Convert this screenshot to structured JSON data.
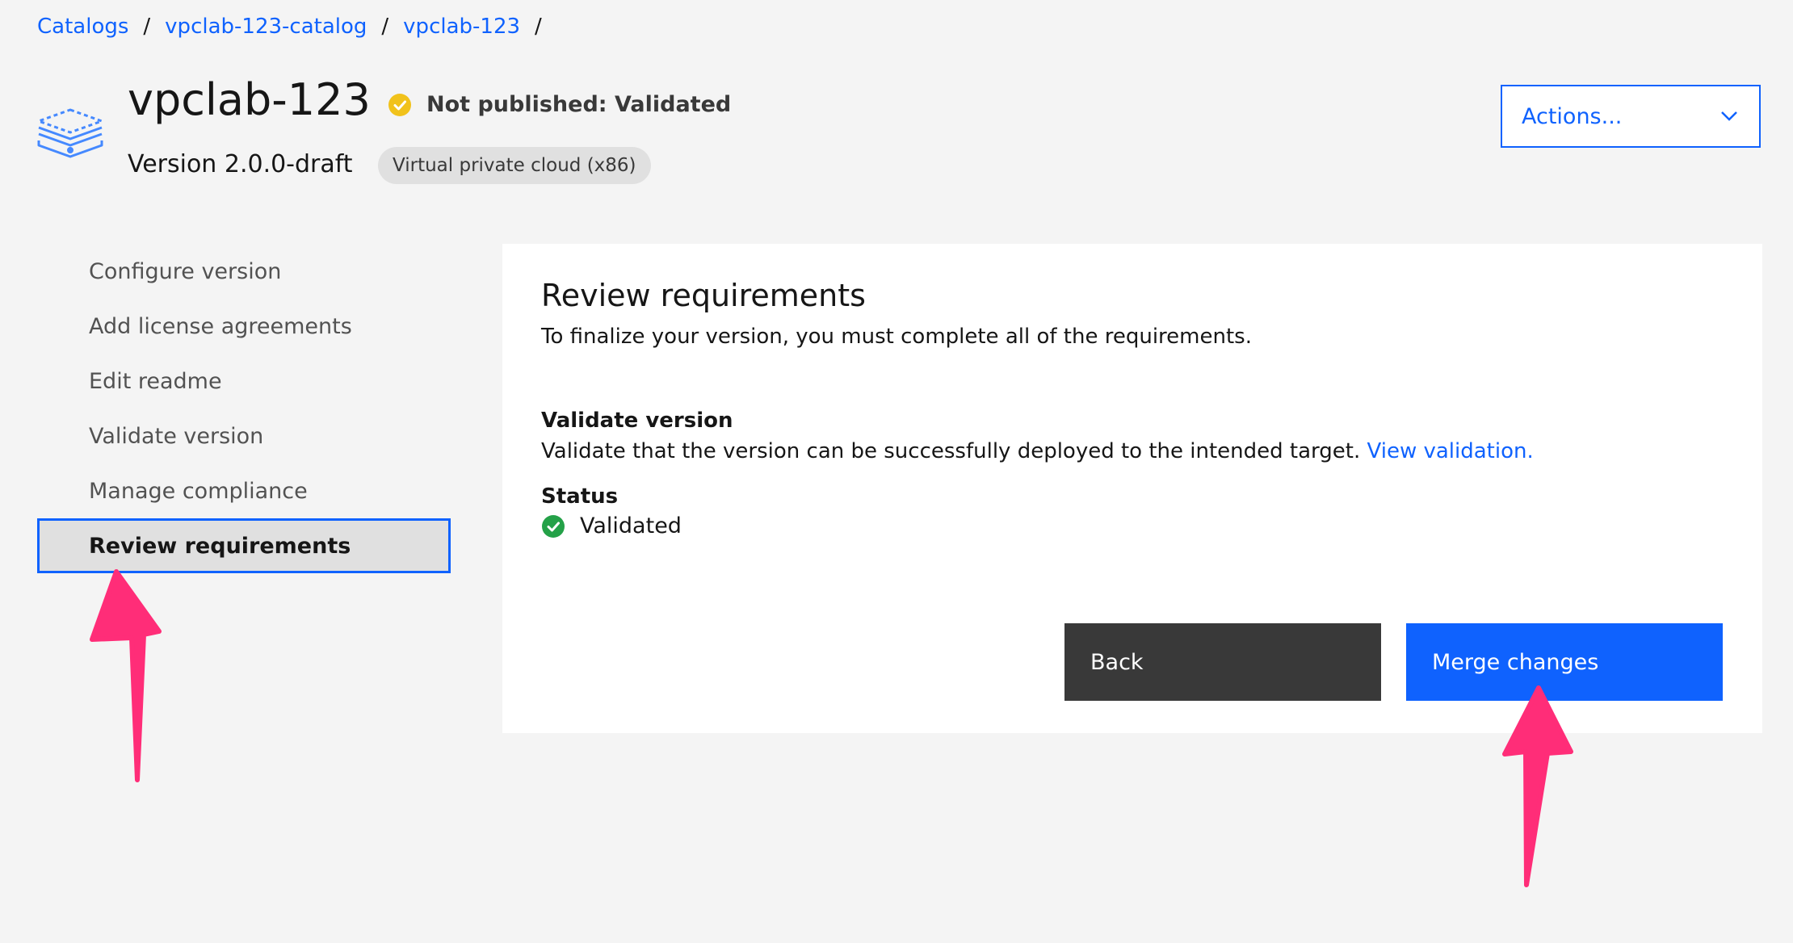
{
  "breadcrumb": {
    "items": [
      "Catalogs",
      "vpclab-123-catalog",
      "vpclab-123"
    ],
    "separator": "/"
  },
  "header": {
    "title": "vpclab-123",
    "status_text": "Not published: Validated",
    "version": "Version 2.0.0-draft",
    "tag": "Virtual private cloud (x86)",
    "product_icon": "stacked-layers-icon",
    "actions_label": "Actions..."
  },
  "sidebar": {
    "items": [
      {
        "label": "Configure version"
      },
      {
        "label": "Add license agreements"
      },
      {
        "label": "Edit readme"
      },
      {
        "label": "Validate version"
      },
      {
        "label": "Manage compliance"
      },
      {
        "label": "Review requirements",
        "active": true
      }
    ]
  },
  "main": {
    "title": "Review requirements",
    "description": "To finalize your version, you must complete all of the requirements.",
    "validate": {
      "title": "Validate version",
      "description": "Validate that the version can be successfully deployed to the intended target.",
      "link": "View validation."
    },
    "status": {
      "label": "Status",
      "value": "Validated"
    },
    "buttons": {
      "back": "Back",
      "merge": "Merge changes"
    }
  },
  "colors": {
    "accent": "#0f62fe",
    "warning": "#f1c21b",
    "success": "#24a148",
    "annotation_arrow": "#ff2d78"
  }
}
